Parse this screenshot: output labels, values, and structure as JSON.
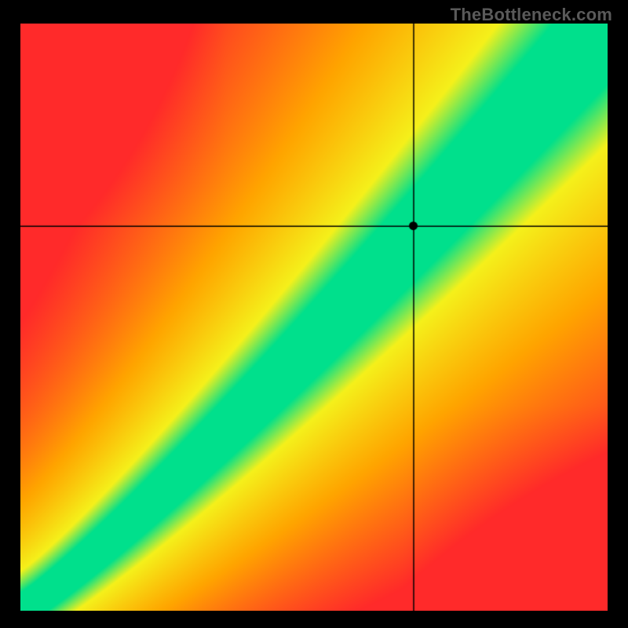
{
  "watermark": "TheBottleneck.com",
  "chart_data": {
    "type": "heatmap",
    "title": "",
    "xlabel": "",
    "ylabel": "",
    "xlim": [
      0,
      1
    ],
    "ylim": [
      0,
      1
    ],
    "crosshair": {
      "x": 0.67,
      "y": 0.655
    },
    "marker": {
      "x": 0.67,
      "y": 0.655
    },
    "diagonal_band": {
      "description": "Green optimal band along a slightly >1 slope diagonal from bottom-left to top-right, transitioning through yellow to orange to red away from the band.",
      "core_half_width": 0.035,
      "yellow_half_width": 0.13,
      "curve_exponent": 1.12
    },
    "palette": {
      "green": "#00E08C",
      "yellow": "#F5F11B",
      "orange": "#FFA500",
      "red": "#FF2A2A"
    }
  }
}
